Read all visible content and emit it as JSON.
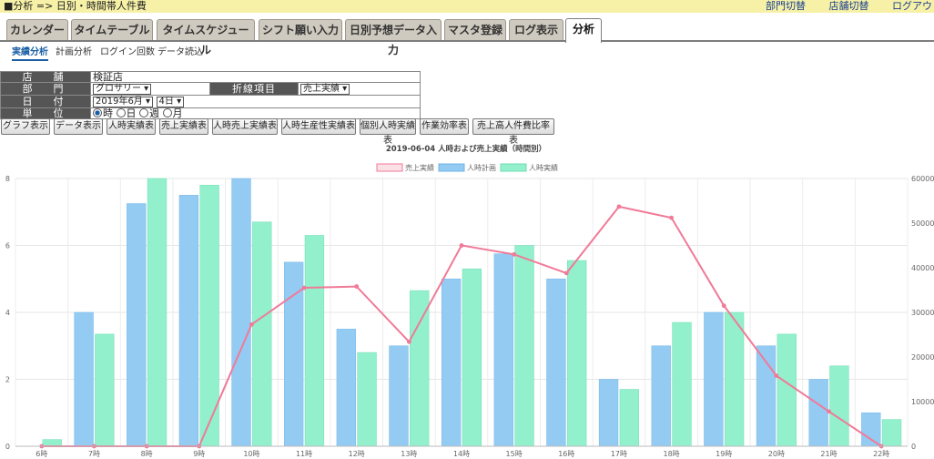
{
  "header": {
    "breadcrumb": "■分析 => 日別・時間帯人件費",
    "links": [
      "部門切替",
      "店舗切替",
      "ログアウ"
    ]
  },
  "tabs": [
    "カレンダー",
    "タイムテーブル",
    "タイムスケジュール",
    "シフト願い入力",
    "日別予想データ入力",
    "マスタ登録",
    "ログ表示",
    "分析"
  ],
  "active_tab": "分析",
  "subtabs": [
    "実績分析",
    "計画分析",
    "ログイン回数",
    "データ読込"
  ],
  "form": {
    "store_label": "店　舗",
    "store_value": "検証店",
    "dept_label": "部　門",
    "dept_value": "グロサリー",
    "line_label": "折線項目",
    "line_value": "売上実績",
    "date_label": "日　付",
    "date_month": "2019年6月",
    "date_day": "4日",
    "unit_label": "単　位",
    "unit_options": [
      "時",
      "日",
      "週",
      "月"
    ],
    "unit_selected": "時"
  },
  "buttons": [
    "グラフ表示",
    "データ表示",
    "人時実績表",
    "売上実績表",
    "人時売上実績表",
    "人時生産性実績表",
    "個別人時実績表",
    "作業効率表",
    "売上高人件費比率表"
  ],
  "colors": {
    "sales": "#f07a98",
    "plan": "#94cbf3",
    "actual": "#93f0cc"
  },
  "chart_data": {
    "type": "bar",
    "title": "2019-06-04 人時および売上実績（時間別）",
    "categories": [
      "6時",
      "7時",
      "8時",
      "9時",
      "10時",
      "11時",
      "12時",
      "13時",
      "14時",
      "15時",
      "16時",
      "17時",
      "18時",
      "19時",
      "20時",
      "21時",
      "22時"
    ],
    "series": [
      {
        "name": "売上実績",
        "type": "line",
        "axis": "right",
        "values": [
          0,
          0,
          0,
          0,
          27300,
          35500,
          35800,
          23400,
          45000,
          43000,
          38800,
          53700,
          51200,
          31500,
          15800,
          7800,
          0
        ]
      },
      {
        "name": "人時計画",
        "type": "bar",
        "axis": "left",
        "values": [
          0,
          4,
          7.25,
          7.5,
          8,
          5.5,
          3.5,
          3,
          5,
          5.75,
          5,
          2,
          3,
          4,
          3,
          2,
          1
        ]
      },
      {
        "name": "人時実績",
        "type": "bar",
        "axis": "left",
        "values": [
          0.2,
          3.35,
          8,
          7.8,
          6.7,
          6.3,
          2.8,
          4.65,
          5.3,
          6,
          5.55,
          1.7,
          3.7,
          4,
          3.35,
          2.4,
          0.8
        ]
      }
    ],
    "y_left": {
      "min": 0,
      "max": 8,
      "ticks": [
        "0",
        "2",
        "4",
        "6",
        "8"
      ]
    },
    "y_right": {
      "min": 0,
      "max": 60000,
      "ticks": [
        "0",
        "10000",
        "20000",
        "30000",
        "40000",
        "50000",
        "60000"
      ]
    },
    "legend": "top-center",
    "grid": true
  }
}
